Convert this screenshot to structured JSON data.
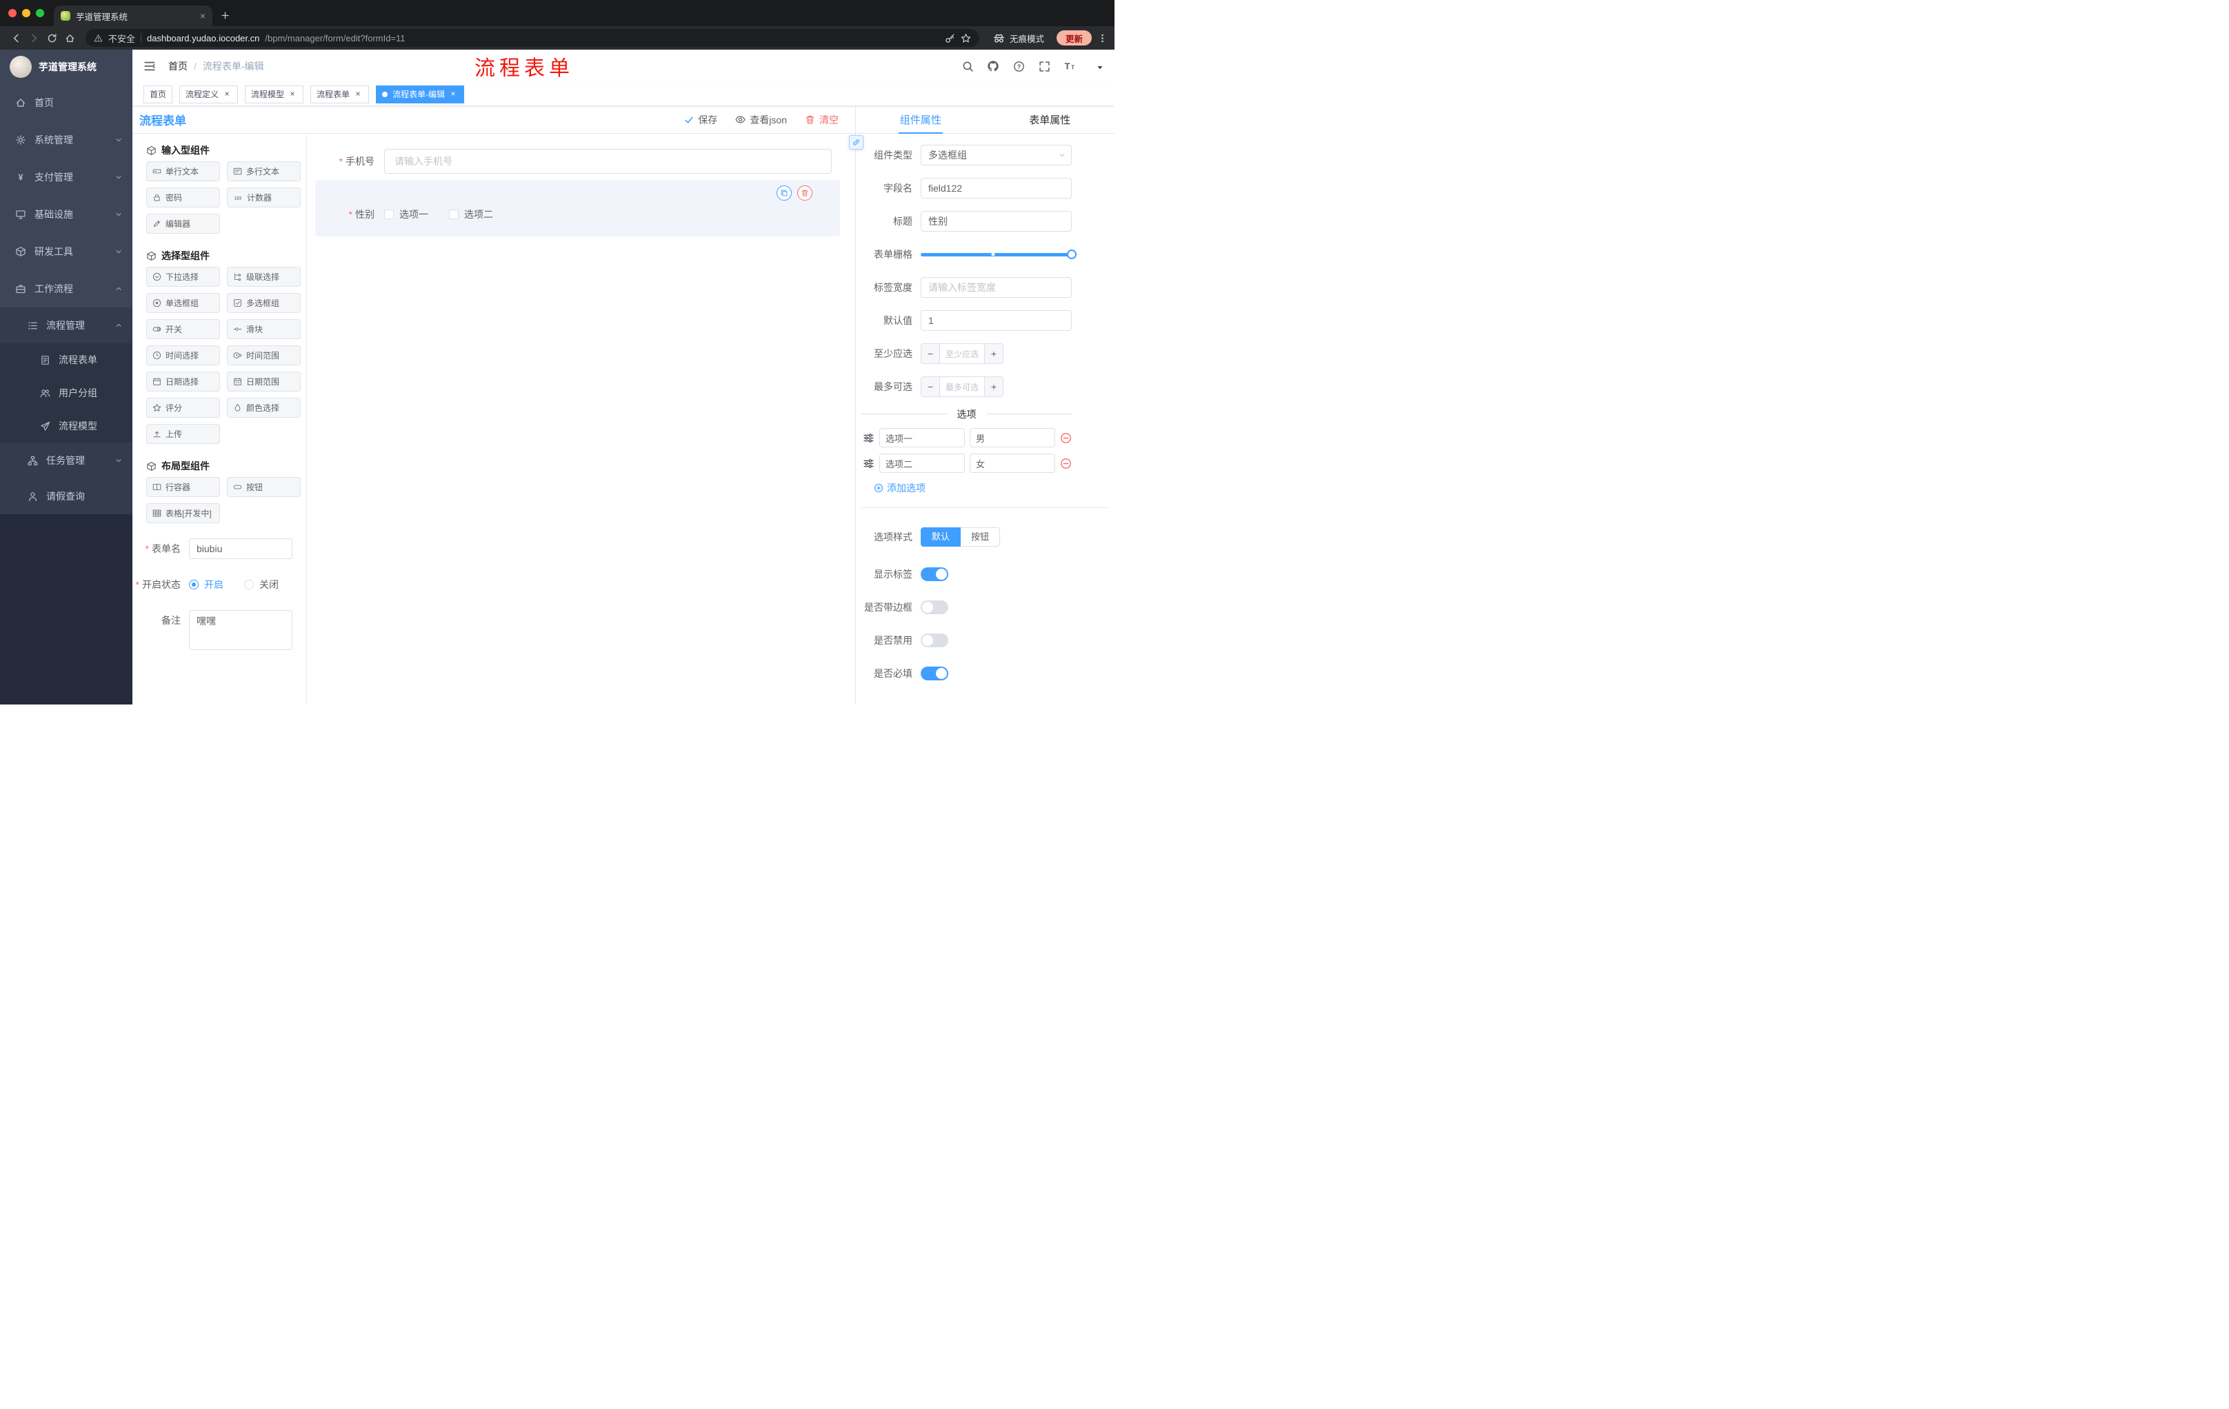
{
  "colors": {
    "accent": "#409eff",
    "danger": "#f56c6c",
    "annotation_red": "#f2190e",
    "sidebar_bg": "#3e4557"
  },
  "browser": {
    "tab_title": "芋道管理系统",
    "security": "不安全",
    "url_host": "dashboard.yudao.iocoder.cn",
    "url_path": "/bpm/manager/form/edit?formId=11",
    "incognito": "无痕模式",
    "update": "更新",
    "toolbar_icons": [
      "back",
      "forward",
      "reload",
      "home",
      "key",
      "star",
      "incognito",
      "more-vertical"
    ]
  },
  "sidebar": {
    "brand": "芋道管理系统",
    "items": [
      {
        "label": "首页",
        "icon": "home"
      },
      {
        "label": "系统管理",
        "icon": "gear"
      },
      {
        "label": "支付管理",
        "icon": "yen"
      },
      {
        "label": "基础设施",
        "icon": "monitor"
      },
      {
        "label": "研发工具",
        "icon": "cube"
      },
      {
        "label": "工作流程",
        "icon": "briefcase"
      },
      {
        "label": "流程管理",
        "icon": "list"
      },
      {
        "label": "流程表单",
        "icon": "document"
      },
      {
        "label": "用户分组",
        "icon": "users"
      },
      {
        "label": "流程模型",
        "icon": "send"
      },
      {
        "label": "任务管理",
        "icon": "org-tree"
      },
      {
        "label": "请假查询",
        "icon": "person"
      }
    ]
  },
  "header": {
    "breadcrumb_home": "首页",
    "breadcrumb_sep": "/",
    "breadcrumb_current": "流程表单-编辑",
    "annotation": "流程表单",
    "icons": [
      "search",
      "github",
      "help",
      "fullscreen",
      "font-size",
      "avatar"
    ]
  },
  "tags": {
    "items": [
      {
        "label": "首页"
      },
      {
        "label": "流程定义"
      },
      {
        "label": "流程模型"
      },
      {
        "label": "流程表单"
      },
      {
        "label": "流程表单-编辑"
      }
    ]
  },
  "designer": {
    "title": "流程表单",
    "save": "保存",
    "view_json": "查看json",
    "clear": "清空",
    "sections": [
      {
        "title": "输入型组件",
        "items": [
          {
            "label": "单行文本",
            "icon": "single-line"
          },
          {
            "label": "多行文本",
            "icon": "multi-line"
          },
          {
            "label": "密码",
            "icon": "lock"
          },
          {
            "label": "计数器",
            "icon": "counter"
          },
          {
            "label": "编辑器",
            "icon": "pencil"
          }
        ]
      },
      {
        "title": "选择型组件",
        "items": [
          {
            "label": "下拉选择",
            "icon": "select"
          },
          {
            "label": "级联选择",
            "icon": "cascader"
          },
          {
            "label": "单选框组",
            "icon": "radio"
          },
          {
            "label": "多选框组",
            "icon": "checkbox"
          },
          {
            "label": "开关",
            "icon": "switch"
          },
          {
            "label": "滑块",
            "icon": "slider"
          },
          {
            "label": "时间选择",
            "icon": "clock"
          },
          {
            "label": "时间范围",
            "icon": "clock-range"
          },
          {
            "label": "日期选择",
            "icon": "calendar"
          },
          {
            "label": "日期范围",
            "icon": "calendar-range"
          },
          {
            "label": "评分",
            "icon": "star"
          },
          {
            "label": "颜色选择",
            "icon": "droplet"
          },
          {
            "label": "上传",
            "icon": "upload"
          }
        ]
      },
      {
        "title": "布局型组件",
        "items": [
          {
            "label": "行容器",
            "icon": "columns"
          },
          {
            "label": "按钮",
            "icon": "button"
          },
          {
            "label": "表格[开发中]",
            "icon": "table"
          }
        ]
      }
    ],
    "meta": {
      "form_name_label": "表单名",
      "form_name_value": "biubiu",
      "status_label": "开启状态",
      "status_on": "开启",
      "status_off": "关闭",
      "remark_label": "备注",
      "remark_value": "嘿嘿"
    },
    "canvas": {
      "phone_label": "手机号",
      "phone_placeholder": "请输入手机号",
      "gender_label": "性别",
      "gender_options": [
        {
          "label": "选项一"
        },
        {
          "label": "选项二"
        }
      ]
    }
  },
  "inspector": {
    "tab_component": "组件属性",
    "tab_form": "表单属性",
    "type_label": "组件类型",
    "type_value": "多选框组",
    "field_label": "字段名",
    "field_value": "field122",
    "title_label": "标题",
    "title_value": "性别",
    "grid_label": "表单栅格",
    "label_width_label": "标签宽度",
    "label_width_placeholder": "请输入标签宽度",
    "default_label": "默认值",
    "default_value": "1",
    "min_label": "至少应选",
    "min_placeholder": "至少应选",
    "max_label": "最多可选",
    "max_placeholder": "最多可选",
    "options_title": "选项",
    "option_rows": [
      {
        "label": "选项一",
        "value": "男"
      },
      {
        "label": "选项二",
        "value": "女"
      }
    ],
    "add_option": "添加选项",
    "style_label": "选项样式",
    "style_default": "默认",
    "style_button": "按钮",
    "switch_show": "显示标签",
    "switch_border": "是否带边框",
    "switch_disabled": "是否禁用",
    "switch_required": "是否必填",
    "switch_states": {
      "show": true,
      "border": false,
      "disabled": false,
      "required": true
    }
  }
}
